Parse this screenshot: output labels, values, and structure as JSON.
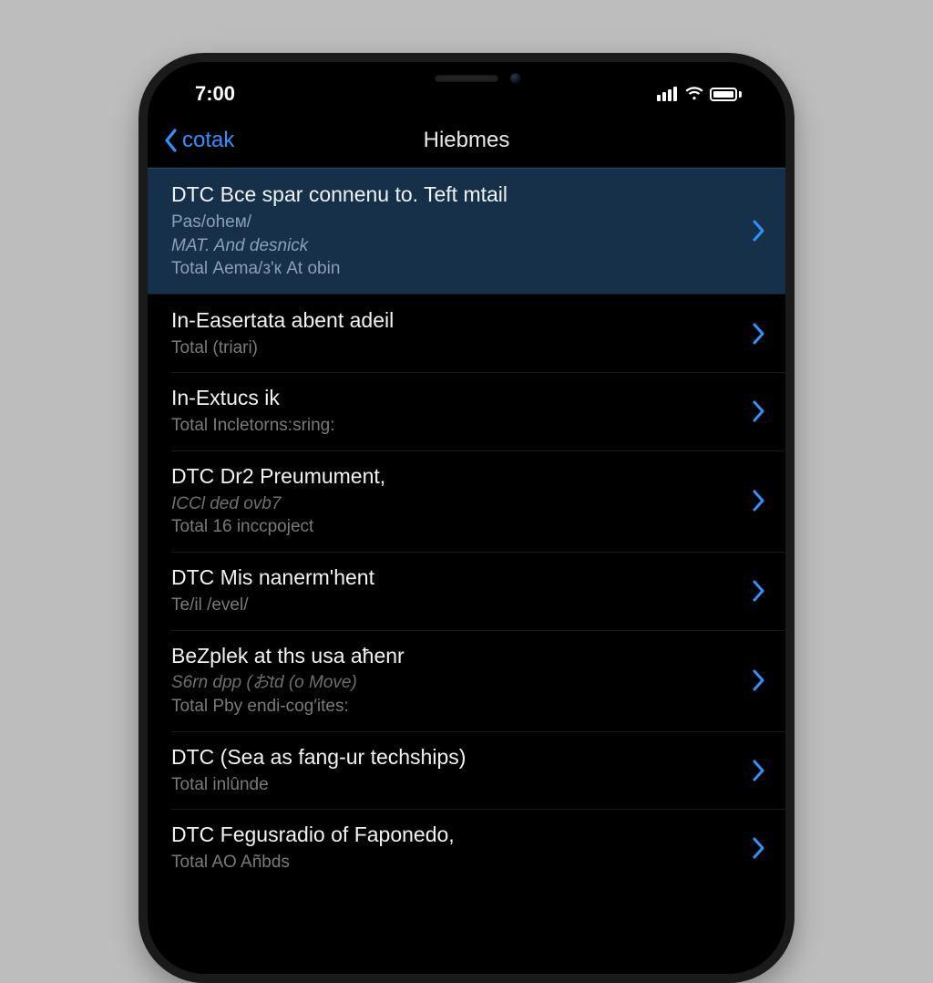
{
  "status": {
    "time": "7:00"
  },
  "nav": {
    "back_label": "cotak",
    "title": "Hiebmes"
  },
  "rows": [
    {
      "title": "DTC Bce spar connenu to. Teft mtail",
      "subs": [
        "Pas/ohем/",
        "MAT. And desnick",
        "Total Аema/з'к At obin"
      ],
      "highlight": true
    },
    {
      "title": "In-Easertata abent adeil",
      "subs": [
        "Total (triari)"
      ]
    },
    {
      "title": "In-Extucs ik",
      "subs": [
        "Total Incletorns:sring:"
      ]
    },
    {
      "title": "DTC Dr2 Preumument,",
      "subs": [
        "ICCl ded ovb7",
        "Total 16 inccpoject"
      ],
      "italicFirst": true
    },
    {
      "title": "DTC Mis nanerm'hent",
      "subs": [
        "Te/il /evel/"
      ]
    },
    {
      "title": "BeZplek at ths usa aћenr",
      "subs": [
        "S6rn dpp (おtd (o Move)",
        "Total Pby endi-cоg′ites:"
      ],
      "italicFirst": true
    },
    {
      "title": "DTC (Sea as fang-ur techships)",
      "subs": [
        "Total inlûnde"
      ]
    },
    {
      "title": "DTC Fegusradio of Faponedo,",
      "subs": [
        "Total AO Añbds"
      ]
    }
  ]
}
